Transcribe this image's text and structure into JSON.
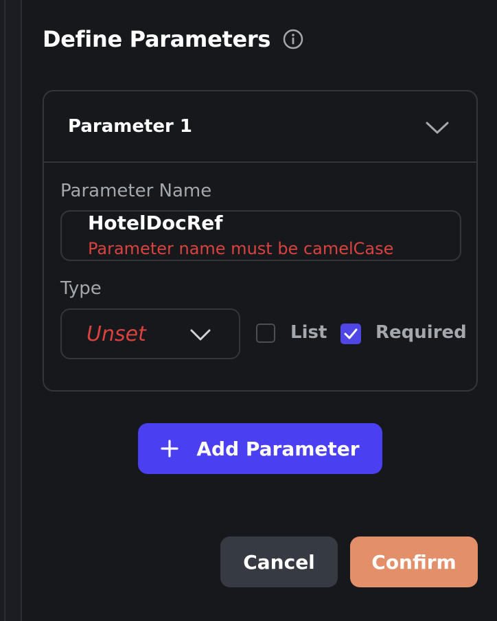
{
  "dialog": {
    "title": "Define Parameters",
    "info_icon": "info-icon"
  },
  "parameter": {
    "header_title": "Parameter 1",
    "collapse_icon": "chevron-down-icon",
    "name_label": "Parameter Name",
    "name_value": "HotelDocRef",
    "name_error": "Parameter name must be camelCase",
    "type_label": "Type",
    "type_value": "Unset",
    "type_icon": "chevron-down-icon",
    "list_label": "List",
    "list_checked": false,
    "required_label": "Required",
    "required_checked": true
  },
  "actions": {
    "add_parameter_label": "Add Parameter",
    "add_icon": "plus-icon",
    "cancel_label": "Cancel",
    "confirm_label": "Confirm"
  },
  "colors": {
    "background": "#16181c",
    "border": "#33363d",
    "error": "#d9423f",
    "primary": "#4b3ff2",
    "confirm": "#e28f6a",
    "secondary_button": "#363a42",
    "muted_text": "#a3a7ae"
  }
}
